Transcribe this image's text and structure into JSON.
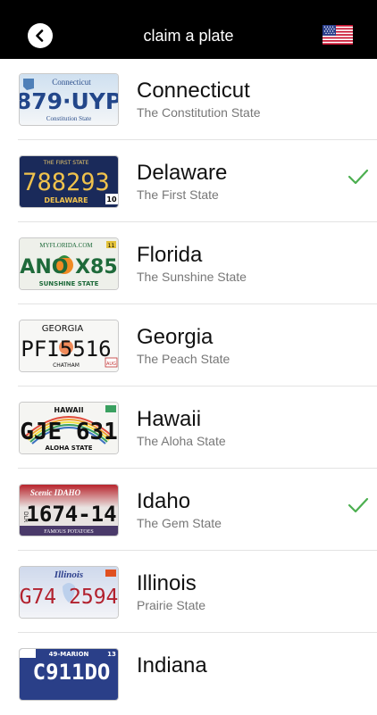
{
  "header": {
    "title": "claim a plate",
    "back_icon": "chevron-left-icon",
    "flag_icon": "us-flag-icon"
  },
  "colors": {
    "header_bg": "#000000",
    "check": "#4caf50",
    "separator": "#e3e3e3",
    "name": "#111111",
    "motto": "#777777"
  },
  "states": [
    {
      "name": "Connecticut",
      "motto": "The Constitution State",
      "claimed": false,
      "plate": {
        "top": "Connecticut",
        "number": "879·UYP",
        "bottom": "Constitution State",
        "side": ""
      }
    },
    {
      "name": "Delaware",
      "motto": "The First State",
      "claimed": true,
      "plate": {
        "top": "THE FIRST STATE",
        "number": "788293",
        "bottom": "DELAWARE",
        "side": "10"
      }
    },
    {
      "name": "Florida",
      "motto": "The Sunshine State",
      "claimed": false,
      "plate": {
        "top": "MYFLORIDA.COM",
        "number": "ANO X85",
        "bottom": "SUNSHINE STATE",
        "side": "11"
      }
    },
    {
      "name": "Georgia",
      "motto": "The Peach State",
      "claimed": false,
      "plate": {
        "top": "GEORGIA",
        "number": "PFI5516",
        "bottom": "CHATHAM",
        "side": "AUG"
      }
    },
    {
      "name": "Hawaii",
      "motto": "The Aloha State",
      "claimed": false,
      "plate": {
        "top": "HAWAII",
        "number": "GJE 631",
        "bottom": "ALOHA STATE",
        "side": ""
      }
    },
    {
      "name": "Idaho",
      "motto": "The Gem State",
      "claimed": true,
      "plate": {
        "top": "Scenic IDAHO",
        "number": "1674-14",
        "bottom": "FAMOUS POTATOES",
        "side": "DLR"
      }
    },
    {
      "name": "Illinois",
      "motto": "Prairie State",
      "claimed": false,
      "plate": {
        "top": "Illinois",
        "number": "G74 2594",
        "bottom": "",
        "side": ""
      }
    },
    {
      "name": "Indiana",
      "motto": "",
      "claimed": false,
      "plate": {
        "top": "49-MARION",
        "number": "C911DO",
        "bottom": "",
        "side": "13"
      }
    }
  ]
}
